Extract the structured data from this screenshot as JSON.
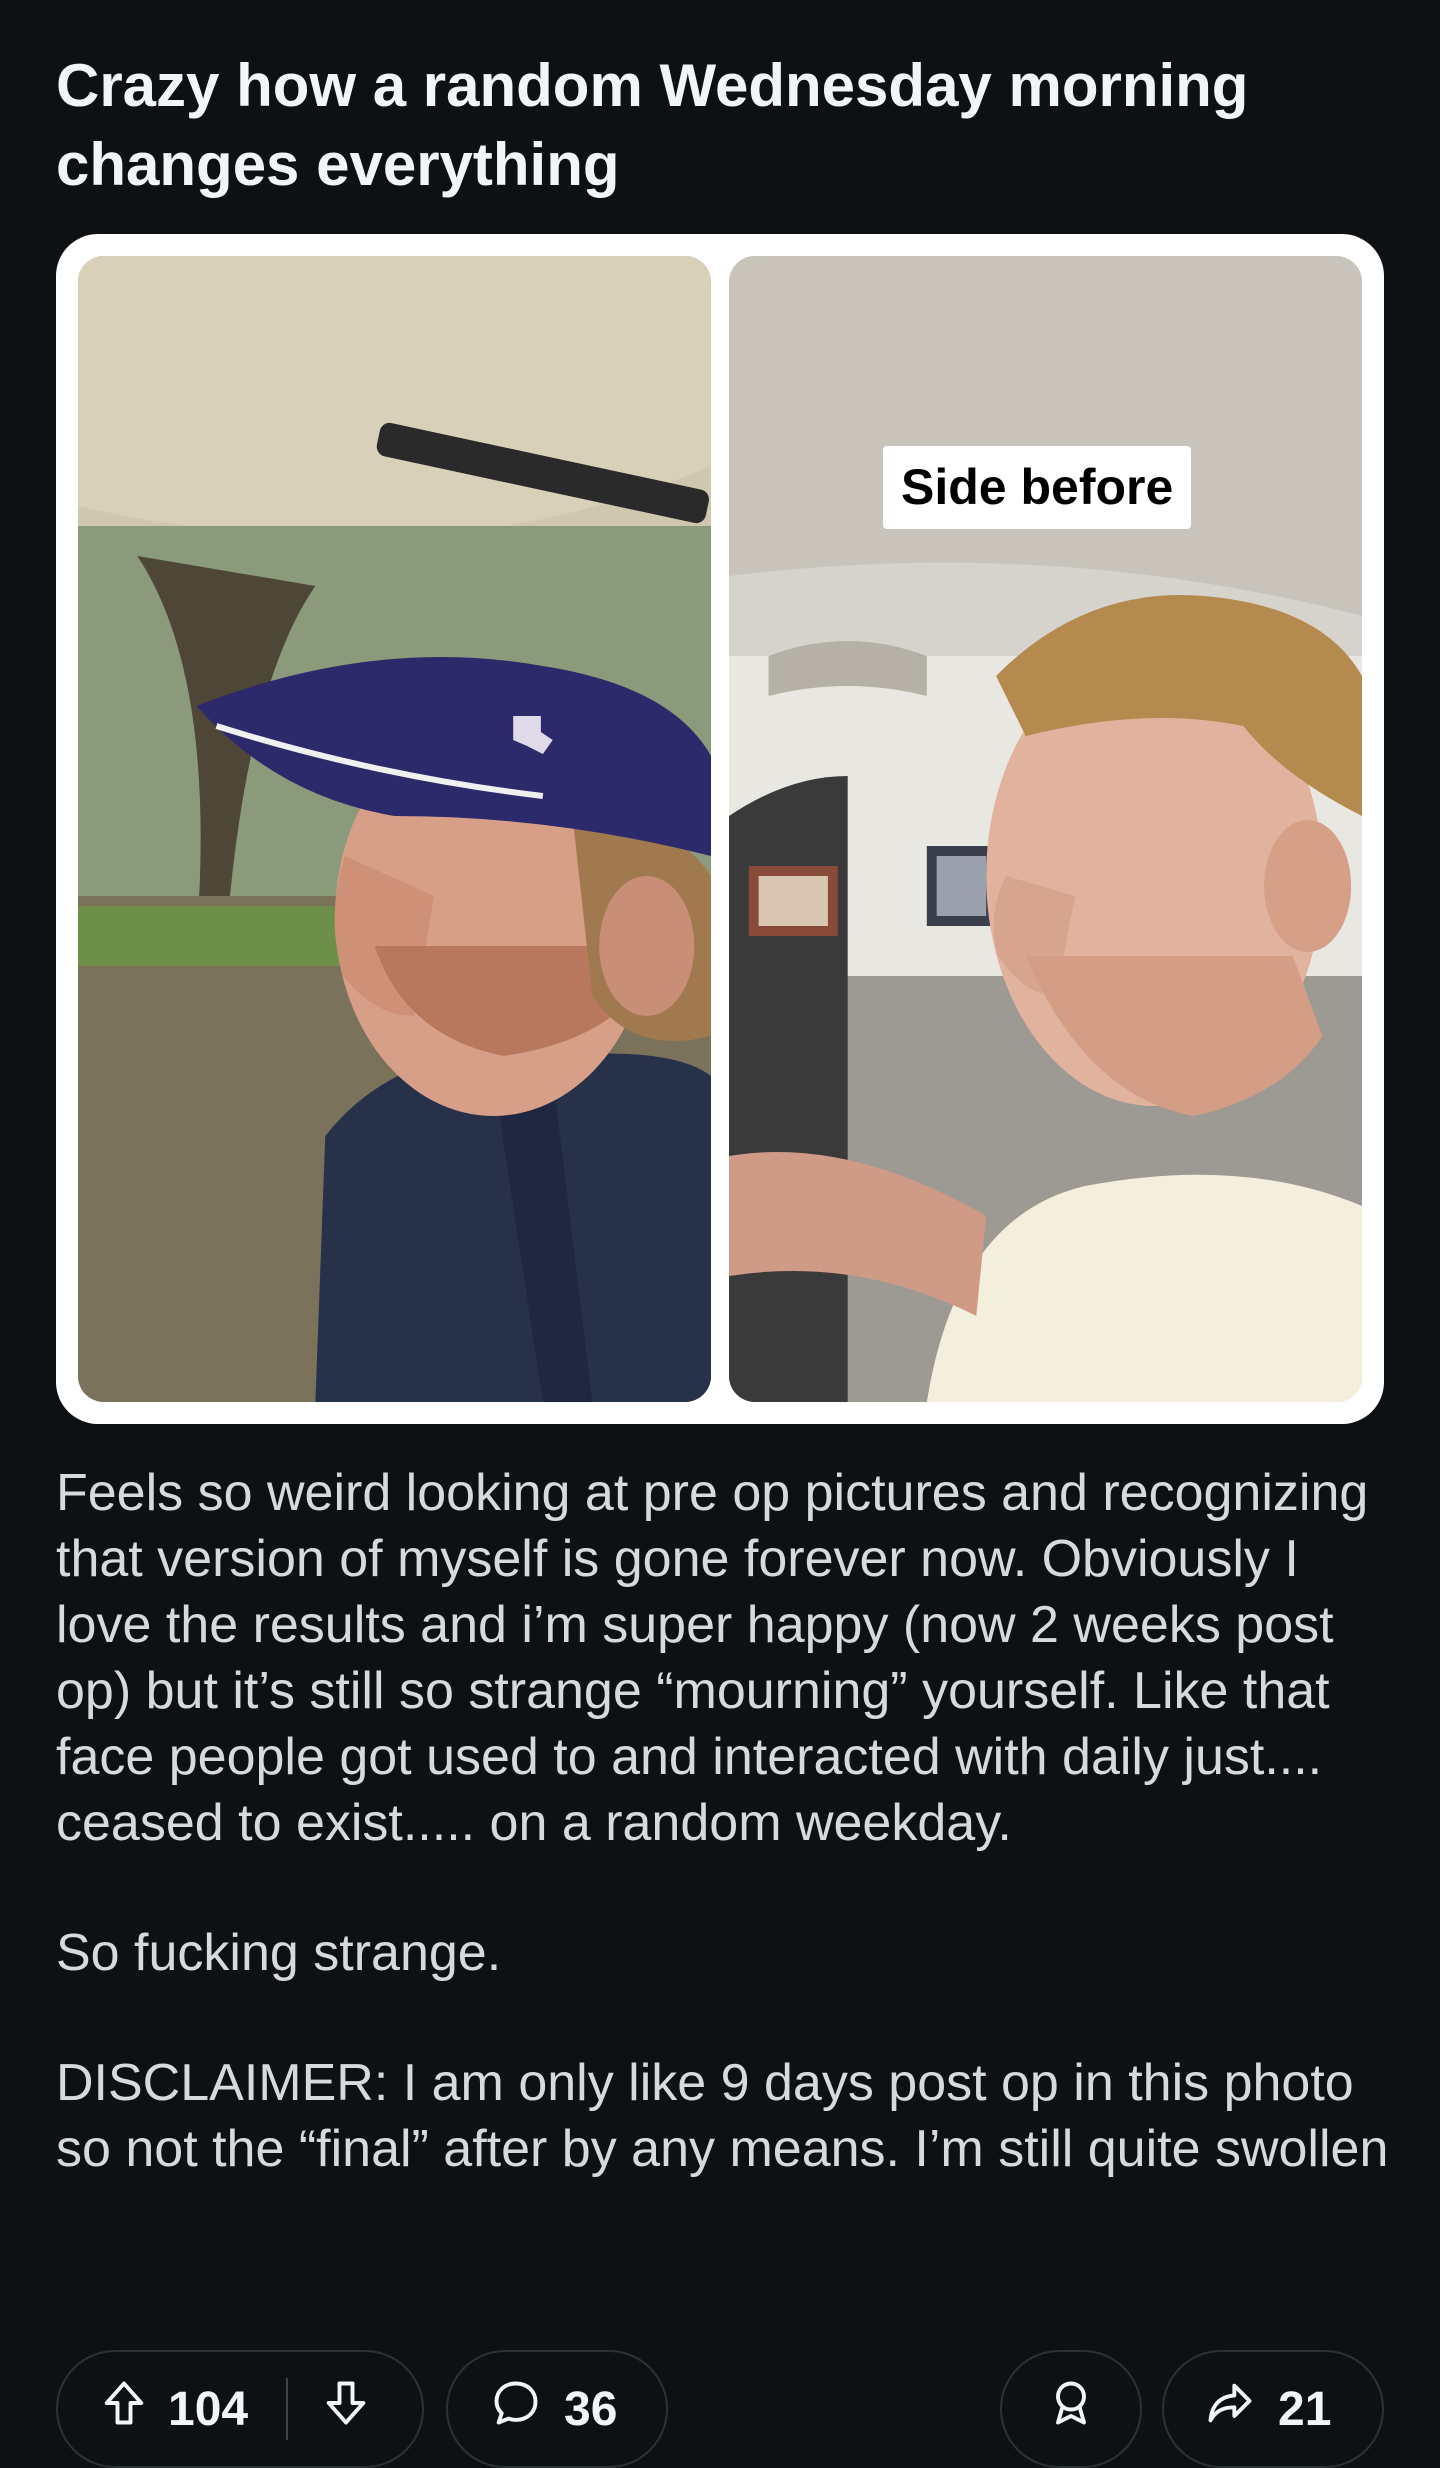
{
  "post": {
    "title": "Crazy how a random Wednesday morning changes everything",
    "image_caption": "Side before",
    "body_paragraphs": [
      "Feels so weird looking at pre op pictures and recognizing that version of myself is gone forever now. Obviously I love the results and i’m super happy (now 2 weeks post op) but it’s still so strange “mourning” yourself. Like that face people got used to and interacted with daily just.... ceased to exist..... on a random weekday.",
      "So fucking strange.",
      "DISCLAIMER: I am only like 9 days post op in this photo so not the “final” after by any means. I’m still quite swollen"
    ]
  },
  "actions": {
    "upvote_count": "104",
    "comment_count": "36",
    "share_count": "21"
  },
  "icons": {
    "upvote": "upvote-arrow-icon",
    "downvote": "downvote-arrow-icon",
    "comment": "comment-bubble-icon",
    "award": "award-icon",
    "share": "share-arrow-icon"
  },
  "colors": {
    "background": "#0e1113",
    "text": "#f2f4f5",
    "body_text": "#d7dadc",
    "pill_border": "#2a3236"
  }
}
